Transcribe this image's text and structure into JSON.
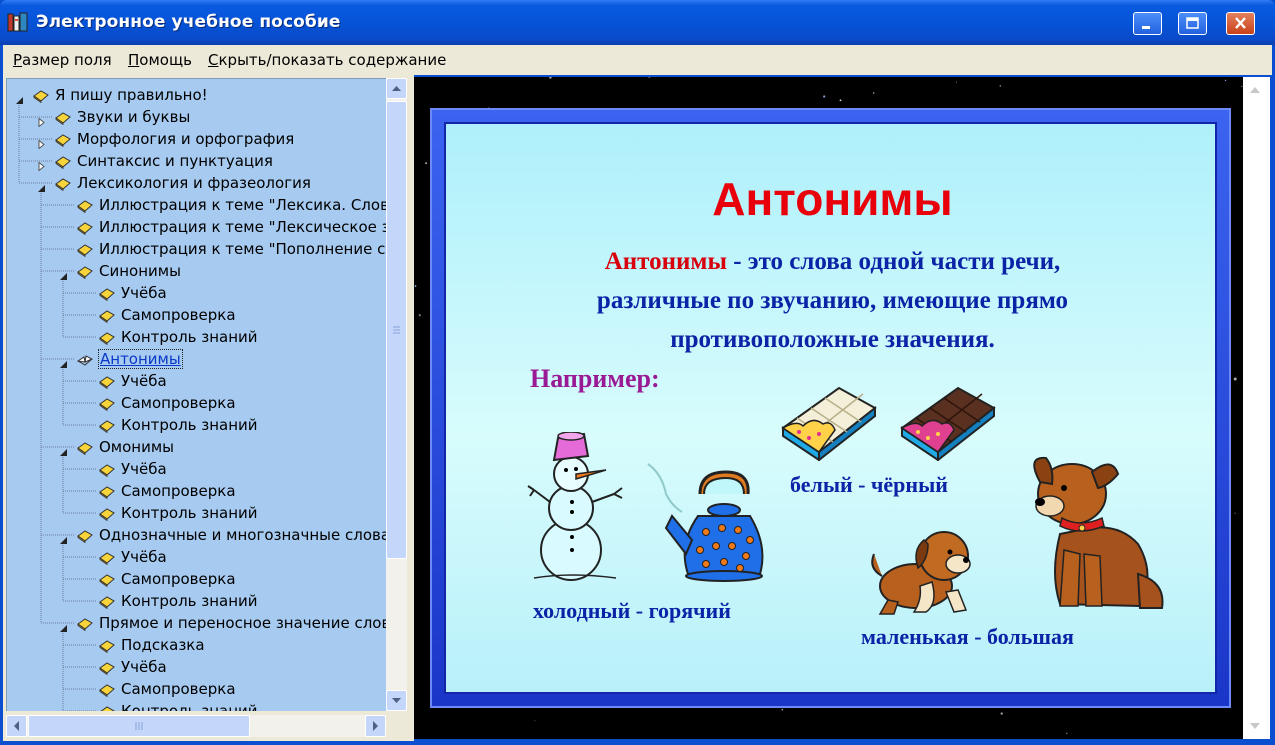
{
  "window": {
    "title": "Электронное учебное пособие"
  },
  "menubar": {
    "items": [
      {
        "label": "Размер поля",
        "accel": "Р",
        "rest": "азмер поля"
      },
      {
        "label": "Помощь",
        "accel": "П",
        "rest": "омощь"
      },
      {
        "label": "Скрыть/показать содержание",
        "accel": "С",
        "rest": "крыть/показать содержание"
      }
    ]
  },
  "tree": {
    "nodes": [
      {
        "label": "Я пишу правильно!",
        "level": 0,
        "expander": "expanded",
        "icon": "closed-book-icon"
      },
      {
        "label": "Звуки и буквы",
        "level": 1,
        "expander": "collapsed",
        "icon": "closed-book-icon"
      },
      {
        "label": "Морфология и орфография",
        "level": 1,
        "expander": "collapsed",
        "icon": "closed-book-icon"
      },
      {
        "label": "Синтаксис и пунктуация",
        "level": 1,
        "expander": "collapsed",
        "icon": "closed-book-icon"
      },
      {
        "label": "Лексикология и фразеология",
        "level": 1,
        "expander": "expanded",
        "icon": "closed-book-icon"
      },
      {
        "label": "Иллюстрация к теме \"Лексика. Слово",
        "level": 2,
        "expander": "none",
        "icon": "closed-book-icon"
      },
      {
        "label": "Иллюстрация к теме \"Лексическое зн",
        "level": 2,
        "expander": "none",
        "icon": "closed-book-icon"
      },
      {
        "label": "Иллюстрация к теме \"Пополнение сл",
        "level": 2,
        "expander": "none",
        "icon": "closed-book-icon"
      },
      {
        "label": "Синонимы",
        "level": 2,
        "expander": "expanded",
        "icon": "closed-book-icon"
      },
      {
        "label": "Учёба",
        "level": 3,
        "expander": "none",
        "icon": "closed-book-icon"
      },
      {
        "label": "Самопроверка",
        "level": 3,
        "expander": "none",
        "icon": "closed-book-icon"
      },
      {
        "label": "Контроль знаний",
        "level": 3,
        "expander": "none",
        "icon": "closed-book-icon"
      },
      {
        "label": "Антонимы",
        "level": 2,
        "expander": "expanded",
        "icon": "open-book-icon",
        "selected": true
      },
      {
        "label": "Учёба",
        "level": 3,
        "expander": "none",
        "icon": "closed-book-icon"
      },
      {
        "label": "Самопроверка",
        "level": 3,
        "expander": "none",
        "icon": "closed-book-icon"
      },
      {
        "label": "Контроль знаний",
        "level": 3,
        "expander": "none",
        "icon": "closed-book-icon"
      },
      {
        "label": "Омонимы",
        "level": 2,
        "expander": "expanded",
        "icon": "closed-book-icon"
      },
      {
        "label": "Учёба",
        "level": 3,
        "expander": "none",
        "icon": "closed-book-icon"
      },
      {
        "label": "Самопроверка",
        "level": 3,
        "expander": "none",
        "icon": "closed-book-icon"
      },
      {
        "label": "Контроль знаний",
        "level": 3,
        "expander": "none",
        "icon": "closed-book-icon"
      },
      {
        "label": "Однозначные и многозначные слова",
        "level": 2,
        "expander": "expanded",
        "icon": "closed-book-icon"
      },
      {
        "label": "Учёба",
        "level": 3,
        "expander": "none",
        "icon": "closed-book-icon"
      },
      {
        "label": "Самопроверка",
        "level": 3,
        "expander": "none",
        "icon": "closed-book-icon"
      },
      {
        "label": "Контроль знаний",
        "level": 3,
        "expander": "none",
        "icon": "closed-book-icon"
      },
      {
        "label": "Прямое и переносное значение слов",
        "level": 2,
        "expander": "expanded",
        "icon": "closed-book-icon"
      },
      {
        "label": "Подсказка",
        "level": 3,
        "expander": "none",
        "icon": "closed-book-icon"
      },
      {
        "label": "Учёба",
        "level": 3,
        "expander": "none",
        "icon": "closed-book-icon"
      },
      {
        "label": "Самопроверка",
        "level": 3,
        "expander": "none",
        "icon": "closed-book-icon"
      },
      {
        "label": "Контроль знаний",
        "level": 3,
        "expander": "none",
        "icon": "closed-book-icon"
      }
    ]
  },
  "slide": {
    "heading": "Антонимы",
    "definition_term": "Антонимы",
    "definition_line1_rest": " - это слова одной части речи,",
    "definition_line2": "различные по звучанию, имеющие прямо",
    "definition_line3": "противоположные значения.",
    "example_label": "Например:",
    "pairs": [
      {
        "caption": "холодный - горячий",
        "images": [
          "snowman-image",
          "kettle-image"
        ]
      },
      {
        "caption": "белый - чёрный",
        "images": [
          "white-chocolate-image",
          "dark-chocolate-image"
        ]
      },
      {
        "caption": "маленькая - большая",
        "images": [
          "puppy-image",
          "dog-image"
        ]
      }
    ]
  },
  "colors": {
    "titlebar": "#0654d8",
    "tree_background": "#a6caf0",
    "slide_background": "#bff7fb",
    "slide_frame": "#1a36c8",
    "heading": "#e8000b",
    "definition": "#0b23a6",
    "example_label": "#9a1a96"
  },
  "icons": {
    "expanded": "triangle-down-icon",
    "collapsed": "triangle-right-icon",
    "node": "yellow-book-icon",
    "selected_node": "open-book-icon"
  }
}
